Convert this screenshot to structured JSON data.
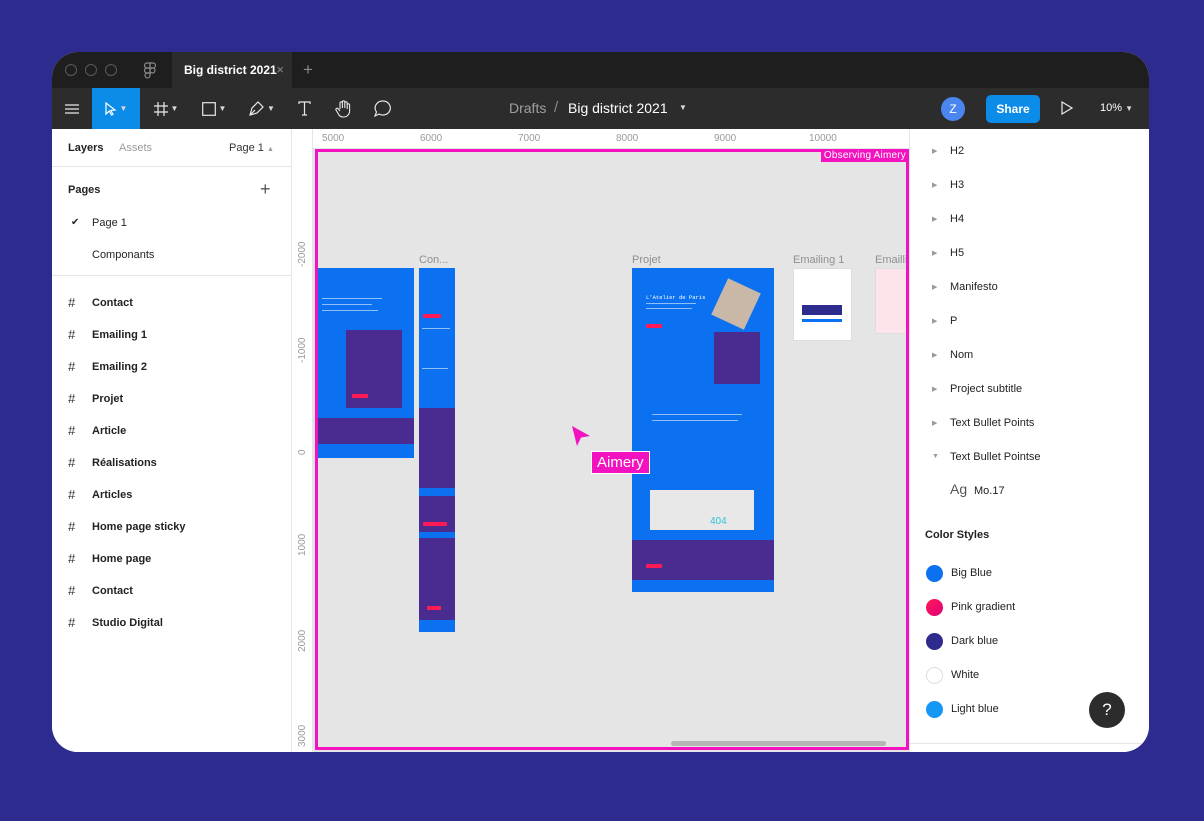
{
  "titlebar": {
    "tab_title": "Big district 2021",
    "tab_close": "×",
    "new_tab": "+"
  },
  "toolbar": {
    "breadcrumb_parent": "Drafts",
    "breadcrumb_sep": "/",
    "file_name": "Big district 2021",
    "avatar_initial": "Z",
    "share_label": "Share",
    "zoom": "10%",
    "tools": [
      "menu-icon",
      "move-icon",
      "frame-icon",
      "rectangle-icon",
      "pen-icon",
      "text-icon",
      "hand-icon",
      "comment-icon"
    ],
    "accent": "#0c8ce9"
  },
  "left_panel": {
    "tab_layers": "Layers",
    "tab_assets": "Assets",
    "page_selector": "Page 1",
    "pages_title": "Pages",
    "pages": [
      "Page 1",
      "Componants"
    ],
    "layers": [
      "Contact",
      "Emailing 1",
      "Emailing 2",
      "Projet",
      "Article",
      "Réalisations",
      "Articles",
      "Home page sticky",
      "Home page",
      "Contact",
      "Studio Digital"
    ]
  },
  "canvas": {
    "ruler_x": [
      "5000",
      "6000",
      "7000",
      "8000",
      "9000",
      "10000"
    ],
    "ruler_y": [
      "-2000",
      "-1000",
      "0",
      "1000",
      "2000",
      "3000"
    ],
    "observing_label": "Observing Aimery",
    "frame_labels": [
      "Con...",
      "Projet",
      "Emailing 1",
      "Emailli"
    ],
    "projet_heading": "L'Atelier de Paris",
    "projet_404": "404",
    "cursor_user": "Aimery",
    "observe_color": "#f312c0"
  },
  "right_panel": {
    "text_styles": [
      "H2",
      "H3",
      "H4",
      "H5",
      "Manifesto",
      "P",
      "Nom",
      "Project subtitle",
      "Text Bullet Points",
      "Text Bullet Pointse"
    ],
    "sub_style_glyph": "Ag",
    "sub_style": "Mo.17",
    "color_styles_title": "Color Styles",
    "colors": [
      {
        "name": "Big Blue",
        "hex": "#0b71f0"
      },
      {
        "name": "Pink gradient",
        "hex": "#ff1a55"
      },
      {
        "name": "Dark blue",
        "hex": "#2e2b8f"
      },
      {
        "name": "White",
        "hex": "#ffffff"
      },
      {
        "name": "Light blue",
        "hex": "#1597f5"
      }
    ],
    "help": "?"
  }
}
